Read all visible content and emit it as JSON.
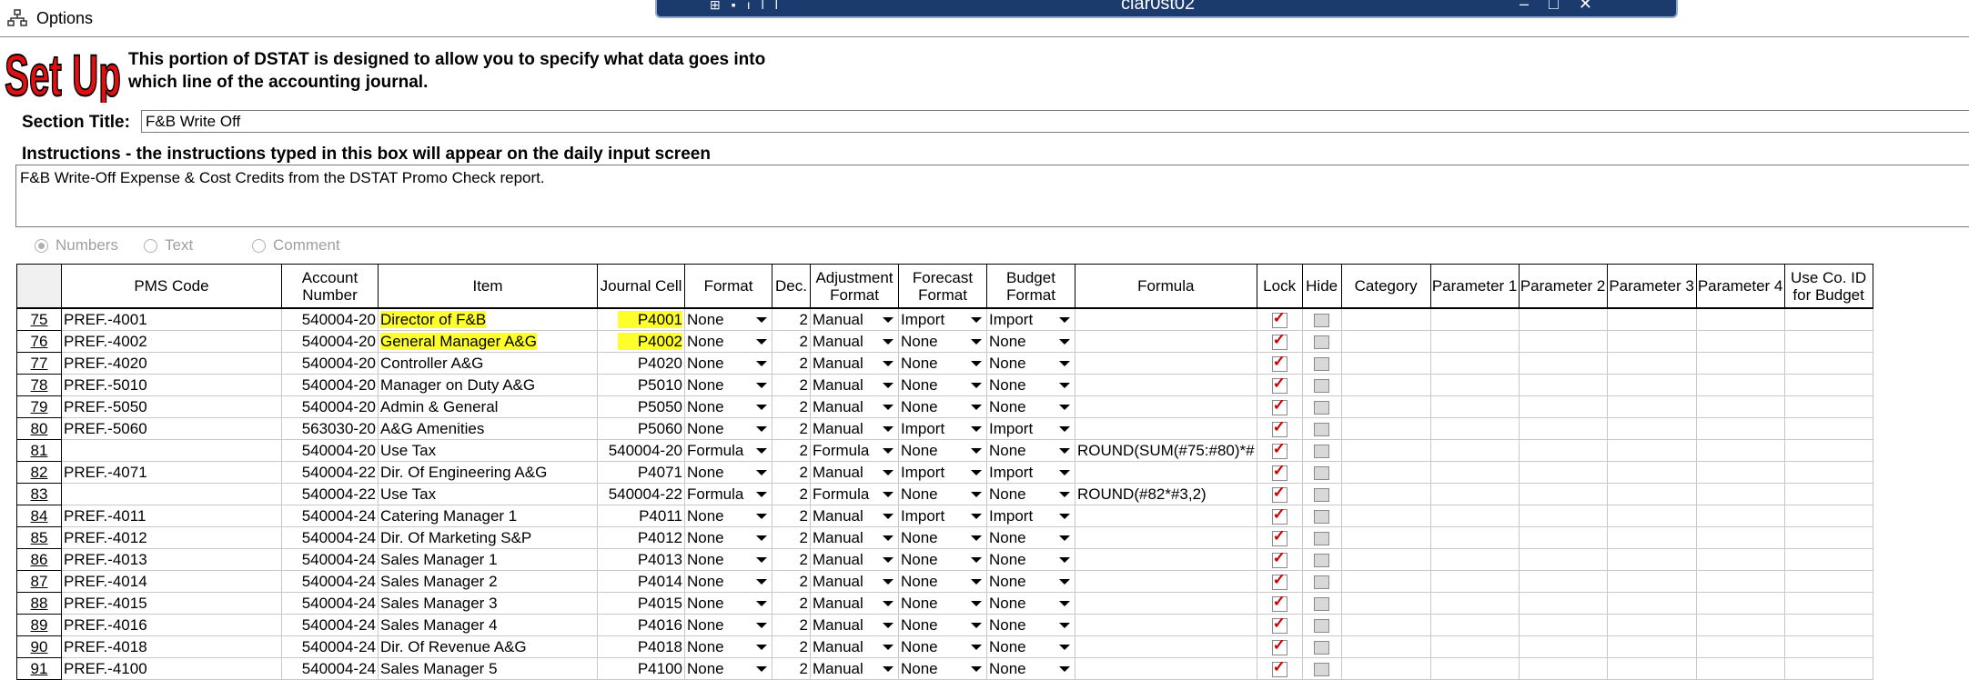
{
  "menu": {
    "options_label": "Options"
  },
  "remote_bar": {
    "title": "clar0st02"
  },
  "setup": {
    "logo_text": "Set Up",
    "description_line1": "This portion of DSTAT is designed to allow you to specify what data goes into",
    "description_line2": "which line of the accounting journal."
  },
  "section": {
    "label": "Section Title:",
    "value": "F&B Write Off"
  },
  "instructions": {
    "label": "Instructions - the instructions typed in this box will appear on the daily input screen",
    "value": "F&B Write-Off Expense & Cost Credits from the DSTAT Promo Check report."
  },
  "value_type": {
    "options": [
      "Numbers",
      "Text",
      "Comment"
    ],
    "selected": "Numbers"
  },
  "grid": {
    "columns": [
      "",
      "PMS Code",
      "Account Number",
      "Item",
      "Journal Cell",
      "Format",
      "Dec.",
      "Adjustment Format",
      "Forecast Format",
      "Budget Format",
      "Formula",
      "Lock",
      "Hide",
      "Category",
      "Parameter 1",
      "Parameter 2",
      "Parameter 3",
      "Parameter 4",
      "Use Co. ID for Budget"
    ],
    "rows": [
      {
        "num": "75",
        "pms": "PREF.-4001",
        "acct": "540004-20",
        "item": "Director of F&B",
        "cell": "P4001",
        "format": "None",
        "dec": "2",
        "adj": "Manual",
        "fc": "Import",
        "bud": "Import",
        "formula": "",
        "lock": true,
        "hide": false,
        "highlight": true
      },
      {
        "num": "76",
        "pms": "PREF.-4002",
        "acct": "540004-20",
        "item": "General Manager A&G",
        "cell": "P4002",
        "format": "None",
        "dec": "2",
        "adj": "Manual",
        "fc": "None",
        "bud": "None",
        "formula": "",
        "lock": true,
        "hide": false,
        "highlight": true
      },
      {
        "num": "77",
        "pms": "PREF.-4020",
        "acct": "540004-20",
        "item": "Controller A&G",
        "cell": "P4020",
        "format": "None",
        "dec": "2",
        "adj": "Manual",
        "fc": "None",
        "bud": "None",
        "formula": "",
        "lock": true,
        "hide": false,
        "highlight": false
      },
      {
        "num": "78",
        "pms": "PREF.-5010",
        "acct": "540004-20",
        "item": "Manager on Duty A&G",
        "cell": "P5010",
        "format": "None",
        "dec": "2",
        "adj": "Manual",
        "fc": "None",
        "bud": "None",
        "formula": "",
        "lock": true,
        "hide": false,
        "highlight": false
      },
      {
        "num": "79",
        "pms": "PREF.-5050",
        "acct": "540004-20",
        "item": "Admin & General",
        "cell": "P5050",
        "format": "None",
        "dec": "2",
        "adj": "Manual",
        "fc": "None",
        "bud": "None",
        "formula": "",
        "lock": true,
        "hide": false,
        "highlight": false
      },
      {
        "num": "80",
        "pms": "PREF.-5060",
        "acct": "563030-20",
        "item": "A&G Amenities",
        "cell": "P5060",
        "format": "None",
        "dec": "2",
        "adj": "Manual",
        "fc": "Import",
        "bud": "Import",
        "formula": "",
        "lock": true,
        "hide": false,
        "highlight": false
      },
      {
        "num": "81",
        "pms": "",
        "acct": "540004-20",
        "item": "Use Tax",
        "cell": "540004-20",
        "format": "Formula",
        "dec": "2",
        "adj": "Formula",
        "fc": "None",
        "bud": "None",
        "formula": "ROUND(SUM(#75:#80)*#",
        "lock": true,
        "hide": false,
        "highlight": false
      },
      {
        "num": "82",
        "pms": "PREF.-4071",
        "acct": "540004-22",
        "item": "Dir. Of Engineering A&G",
        "cell": "P4071",
        "format": "None",
        "dec": "2",
        "adj": "Manual",
        "fc": "Import",
        "bud": "Import",
        "formula": "",
        "lock": true,
        "hide": false,
        "highlight": false
      },
      {
        "num": "83",
        "pms": "",
        "acct": "540004-22",
        "item": "Use Tax",
        "cell": "540004-22",
        "format": "Formula",
        "dec": "2",
        "adj": "Formula",
        "fc": "None",
        "bud": "None",
        "formula": "ROUND(#82*#3,2)",
        "lock": true,
        "hide": false,
        "highlight": false
      },
      {
        "num": "84",
        "pms": "PREF.-4011",
        "acct": "540004-24",
        "item": "Catering Manager 1",
        "cell": "P4011",
        "format": "None",
        "dec": "2",
        "adj": "Manual",
        "fc": "Import",
        "bud": "Import",
        "formula": "",
        "lock": true,
        "hide": false,
        "highlight": false
      },
      {
        "num": "85",
        "pms": "PREF.-4012",
        "acct": "540004-24",
        "item": "Dir. Of Marketing S&P",
        "cell": "P4012",
        "format": "None",
        "dec": "2",
        "adj": "Manual",
        "fc": "None",
        "bud": "None",
        "formula": "",
        "lock": true,
        "hide": false,
        "highlight": false
      },
      {
        "num": "86",
        "pms": "PREF.-4013",
        "acct": "540004-24",
        "item": "Sales Manager 1",
        "cell": "P4013",
        "format": "None",
        "dec": "2",
        "adj": "Manual",
        "fc": "None",
        "bud": "None",
        "formula": "",
        "lock": true,
        "hide": false,
        "highlight": false
      },
      {
        "num": "87",
        "pms": "PREF.-4014",
        "acct": "540004-24",
        "item": "Sales Manager 2",
        "cell": "P4014",
        "format": "None",
        "dec": "2",
        "adj": "Manual",
        "fc": "None",
        "bud": "None",
        "formula": "",
        "lock": true,
        "hide": false,
        "highlight": false
      },
      {
        "num": "88",
        "pms": "PREF.-4015",
        "acct": "540004-24",
        "item": "Sales Manager 3",
        "cell": "P4015",
        "format": "None",
        "dec": "2",
        "adj": "Manual",
        "fc": "None",
        "bud": "None",
        "formula": "",
        "lock": true,
        "hide": false,
        "highlight": false
      },
      {
        "num": "89",
        "pms": "PREF.-4016",
        "acct": "540004-24",
        "item": "Sales Manager 4",
        "cell": "P4016",
        "format": "None",
        "dec": "2",
        "adj": "Manual",
        "fc": "None",
        "bud": "None",
        "formula": "",
        "lock": true,
        "hide": false,
        "highlight": false
      },
      {
        "num": "90",
        "pms": "PREF.-4018",
        "acct": "540004-24",
        "item": "Dir. Of Revenue A&G",
        "cell": "P4018",
        "format": "None",
        "dec": "2",
        "adj": "Manual",
        "fc": "None",
        "bud": "None",
        "formula": "",
        "lock": true,
        "hide": false,
        "highlight": false
      },
      {
        "num": "91",
        "pms": "PREF.-4100",
        "acct": "540004-24",
        "item": "Sales Manager 5",
        "cell": "P4100",
        "format": "None",
        "dec": "2",
        "adj": "Manual",
        "fc": "None",
        "bud": "None",
        "formula": "",
        "lock": true,
        "hide": false,
        "highlight": false
      }
    ]
  },
  "colors": {
    "highlight": "#ffff2b",
    "lock_check": "#d00000",
    "titlebar": "#1b3a6d"
  }
}
